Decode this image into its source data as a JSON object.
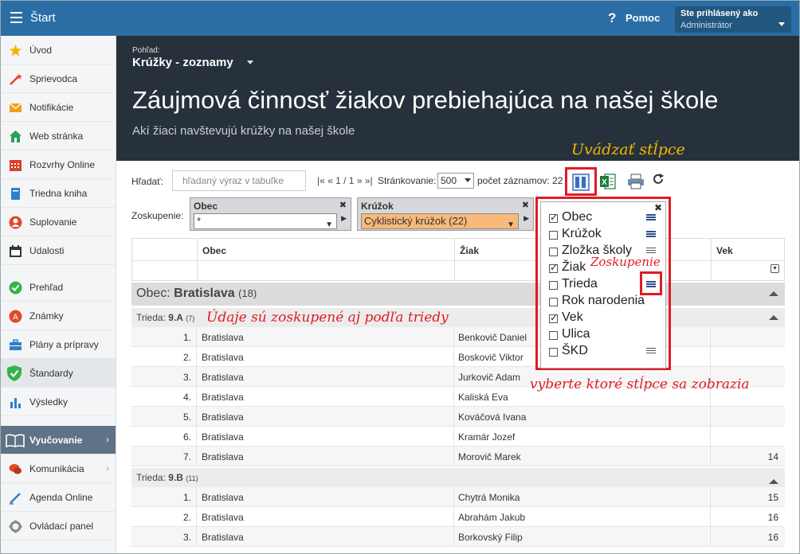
{
  "topbar": {
    "title": "Štart",
    "help": "Pomoc",
    "help_icon": "?",
    "user_line1": "Ste prihlásený ako",
    "user_line2": "Administrátor"
  },
  "sidebar": {
    "items": [
      {
        "label": "Úvod",
        "icon": "star-icon",
        "color": "#f5b400"
      },
      {
        "label": "Sprievodca",
        "icon": "magic-wand-icon",
        "color": "#e04a2a"
      },
      {
        "label": "Notifikácie",
        "icon": "envelope-icon",
        "color": "#f0a020"
      },
      {
        "label": "Web stránka",
        "icon": "house-icon",
        "color": "#2aa05a"
      },
      {
        "label": "Rozvrhy Online",
        "icon": "calendar-grid-icon",
        "color": "#d9412d"
      },
      {
        "label": "Triedna kniha",
        "icon": "book-icon",
        "color": "#2f80c9"
      },
      {
        "label": "Suplovanie",
        "icon": "person-icon",
        "color": "#e04a2a"
      },
      {
        "label": "Udalosti",
        "icon": "calendar-icon",
        "color": "#333333"
      },
      {
        "label": "Prehľad",
        "icon": "check-circle-icon",
        "color": "#35b34a"
      },
      {
        "label": "Známky",
        "icon": "grade-circle-icon",
        "color": "#e04a2a"
      },
      {
        "label": "Plány a prípravy",
        "icon": "briefcase-icon",
        "color": "#2f80c9"
      },
      {
        "label": "Štandardy",
        "icon": "shield-check-icon",
        "color": "#35b34a"
      },
      {
        "label": "Výsledky",
        "icon": "bar-chart-icon",
        "color": "#2f80c9"
      },
      {
        "label": "Vyučovanie",
        "icon": "open-book-icon",
        "color": "#ffffff"
      },
      {
        "label": "Komunikácia",
        "icon": "chat-icon",
        "color": "#e04a2a"
      },
      {
        "label": "Agenda Online",
        "icon": "pen-icon",
        "color": "#2f80c9"
      },
      {
        "label": "Ovládací panel",
        "icon": "gear-icon",
        "color": "#888888"
      }
    ]
  },
  "header": {
    "view_label": "Pohľad:",
    "view_name": "Krúžky - zoznamy",
    "title": "Záujmová činnosť žiakov prebiehajúca na našej škole",
    "subtitle": "Akí žiaci navštevujú krúžky na našej škole"
  },
  "toolbar": {
    "search_label": "Hľadať:",
    "search_placeholder": "hľadaný výraz v tabuľke",
    "pager_text": "|« « 1 / 1 » »|",
    "pager_label": "Stránkovanie:",
    "pager_value": "500",
    "records": "počet záznamov: 22",
    "grouping_label": "Zoskupenie:",
    "group1_title": "Obec",
    "group1_value": "*",
    "group2_title": "Krúžok",
    "group2_value": "Cyklistický krúžok (22)"
  },
  "table": {
    "columns": [
      "Obec",
      "Žiak",
      "Vek"
    ],
    "group_obec_label": "Obec:",
    "group_obec_value": "Bratislava",
    "group_obec_count": "(18)",
    "group_a_label": "Trieda:",
    "group_a_value": "9.A",
    "group_a_count": "(7)",
    "group_b_label": "Trieda:",
    "group_b_value": "9.B",
    "group_b_count": "(11)",
    "rows_a": [
      {
        "n": "1.",
        "obec": "Bratislava",
        "ziak": "Benkovič Daniel",
        "vek": ""
      },
      {
        "n": "2.",
        "obec": "Bratislava",
        "ziak": "Boskovič Viktor",
        "vek": ""
      },
      {
        "n": "3.",
        "obec": "Bratislava",
        "ziak": "Jurkovič Adam",
        "vek": ""
      },
      {
        "n": "4.",
        "obec": "Bratislava",
        "ziak": "Kaliská Eva",
        "vek": ""
      },
      {
        "n": "5.",
        "obec": "Bratislava",
        "ziak": "Kováčová Ivana",
        "vek": ""
      },
      {
        "n": "6.",
        "obec": "Bratislava",
        "ziak": "Kramár Jozef",
        "vek": ""
      },
      {
        "n": "7.",
        "obec": "Bratislava",
        "ziak": "Morovič Marek",
        "vek": "14"
      }
    ],
    "rows_b": [
      {
        "n": "1.",
        "obec": "Bratislava",
        "ziak": "Chytrá Monika",
        "vek": "15"
      },
      {
        "n": "2.",
        "obec": "Bratislava",
        "ziak": "Abrahám Jakub",
        "vek": "16"
      },
      {
        "n": "3.",
        "obec": "Bratislava",
        "ziak": "Borkovský Filip",
        "vek": "16"
      }
    ]
  },
  "column_popup": {
    "items": [
      {
        "label": "Obec",
        "checked": true,
        "icon": "full"
      },
      {
        "label": "Krúžok",
        "checked": false,
        "icon": "full"
      },
      {
        "label": "Zložka školy",
        "checked": false,
        "icon": "lines"
      },
      {
        "label": "Žiak",
        "checked": true,
        "icon": ""
      },
      {
        "label": "Trieda",
        "checked": false,
        "icon": "full"
      },
      {
        "label": "Rok narodenia",
        "checked": false,
        "icon": ""
      },
      {
        "label": "Vek",
        "checked": true,
        "icon": ""
      },
      {
        "label": "Ulica",
        "checked": false,
        "icon": ""
      },
      {
        "label": "ŠKD",
        "checked": false,
        "icon": "lines"
      }
    ]
  },
  "annotations": {
    "columns_title": "Uvádzať stĺpce",
    "grouping": "Zoskupenie",
    "grouped_by_class": "Údaje sú zoskupené aj podľa triedy",
    "choose_columns": "vyberte ktoré stĺpce sa zobrazia"
  },
  "colors": {
    "topbar": "#2b6ea5",
    "header": "#27313b",
    "highlight": "#e01b24",
    "annotation_yellow": "#f2b800",
    "group_select": "#f9b97a"
  }
}
